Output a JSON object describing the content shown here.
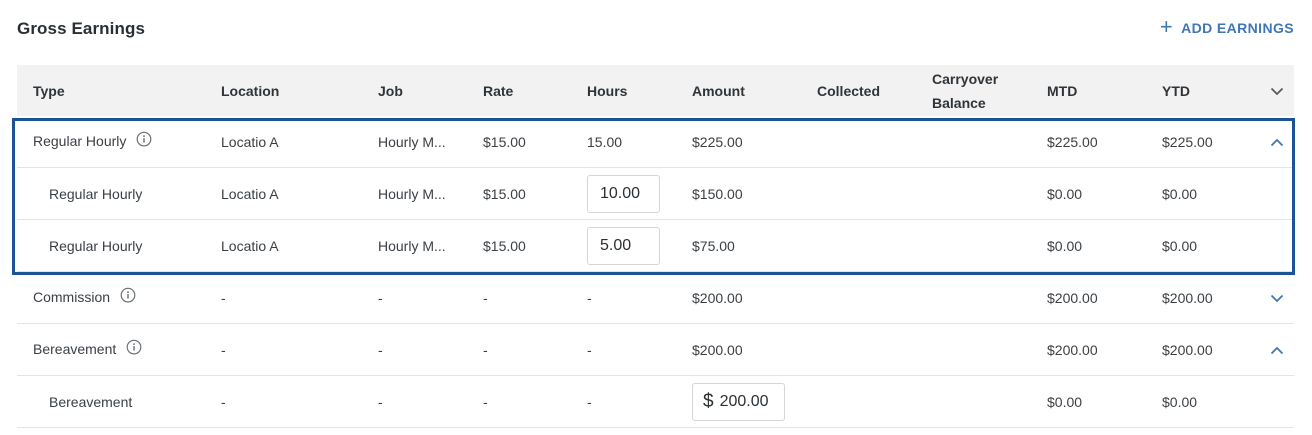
{
  "section": {
    "title": "Gross Earnings",
    "add_label": "ADD EARNINGS",
    "add_icon": "plus-icon"
  },
  "columns": {
    "type": "Type",
    "location": "Location",
    "job": "Job",
    "rate": "Rate",
    "hours": "Hours",
    "amount": "Amount",
    "collected": "Collected",
    "carryover_line1": "Carryover",
    "carryover_line2": "Balance",
    "mtd": "MTD",
    "ytd": "YTD"
  },
  "rows": [
    {
      "type": "Regular Hourly",
      "location": "Locatio A",
      "job": "Hourly M...",
      "rate": "$15.00",
      "hours": "15.00",
      "amount": "$225.00",
      "mtd": "$225.00",
      "ytd": "$225.00"
    },
    {
      "type": "Regular Hourly",
      "location": "Locatio A",
      "job": "Hourly M...",
      "rate": "$15.00",
      "hours": "10.00",
      "amount": "$150.00",
      "mtd": "$0.00",
      "ytd": "$0.00"
    },
    {
      "type": "Regular Hourly",
      "location": "Locatio A",
      "job": "Hourly M...",
      "rate": "$15.00",
      "hours": "5.00",
      "amount": "$75.00",
      "mtd": "$0.00",
      "ytd": "$0.00"
    },
    {
      "type": "Commission",
      "location": "-",
      "job": "-",
      "rate": "-",
      "hours": "-",
      "amount": "$200.00",
      "mtd": "$200.00",
      "ytd": "$200.00"
    },
    {
      "type": "Bereavement",
      "location": "-",
      "job": "-",
      "rate": "-",
      "hours": "-",
      "amount": "$200.00",
      "mtd": "$200.00",
      "ytd": "$200.00"
    },
    {
      "type": "Bereavement",
      "location": "-",
      "job": "-",
      "rate": "-",
      "hours": "-",
      "amount": "200.00",
      "amount_prefix": "$",
      "mtd": "$0.00",
      "ytd": "$0.00"
    }
  ],
  "colors": {
    "accent": "#3f77b5",
    "highlight": "#1b5496",
    "header_bg": "#f2f2f3"
  }
}
